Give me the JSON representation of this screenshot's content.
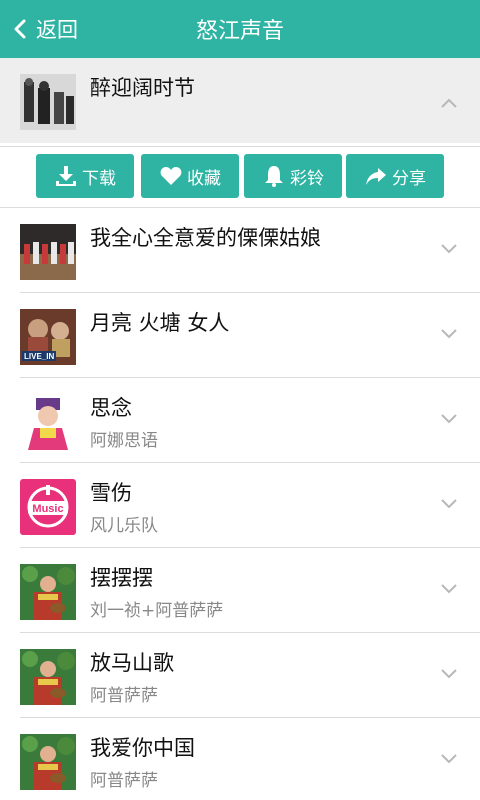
{
  "header": {
    "back_label": "返回",
    "title": "怒江声音",
    "color": "#2fb3a3"
  },
  "expanded_song": {
    "name": "醉迎阔时节",
    "artist": ""
  },
  "actions": [
    {
      "label": "下载",
      "icon": "download-icon"
    },
    {
      "label": "收藏",
      "icon": "heart-icon"
    },
    {
      "label": "彩铃",
      "icon": "bell-icon"
    },
    {
      "label": "分享",
      "icon": "share-icon"
    }
  ],
  "songs": [
    {
      "name": "我全心全意爱的傈傈姑娘",
      "artist": ""
    },
    {
      "name": "月亮 火塘 女人",
      "artist": ""
    },
    {
      "name": "思念",
      "artist": "阿娜思语"
    },
    {
      "name": "雪伤",
      "artist": "风儿乐队"
    },
    {
      "name": "摆摆摆",
      "artist": "刘一祯+阿普萨萨"
    },
    {
      "name": "放马山歌",
      "artist": "阿普萨萨"
    },
    {
      "name": "我爱你中国",
      "artist": "阿普萨萨"
    }
  ],
  "music_badge_text": "Music",
  "live_badge_text": "LIVE_IN"
}
